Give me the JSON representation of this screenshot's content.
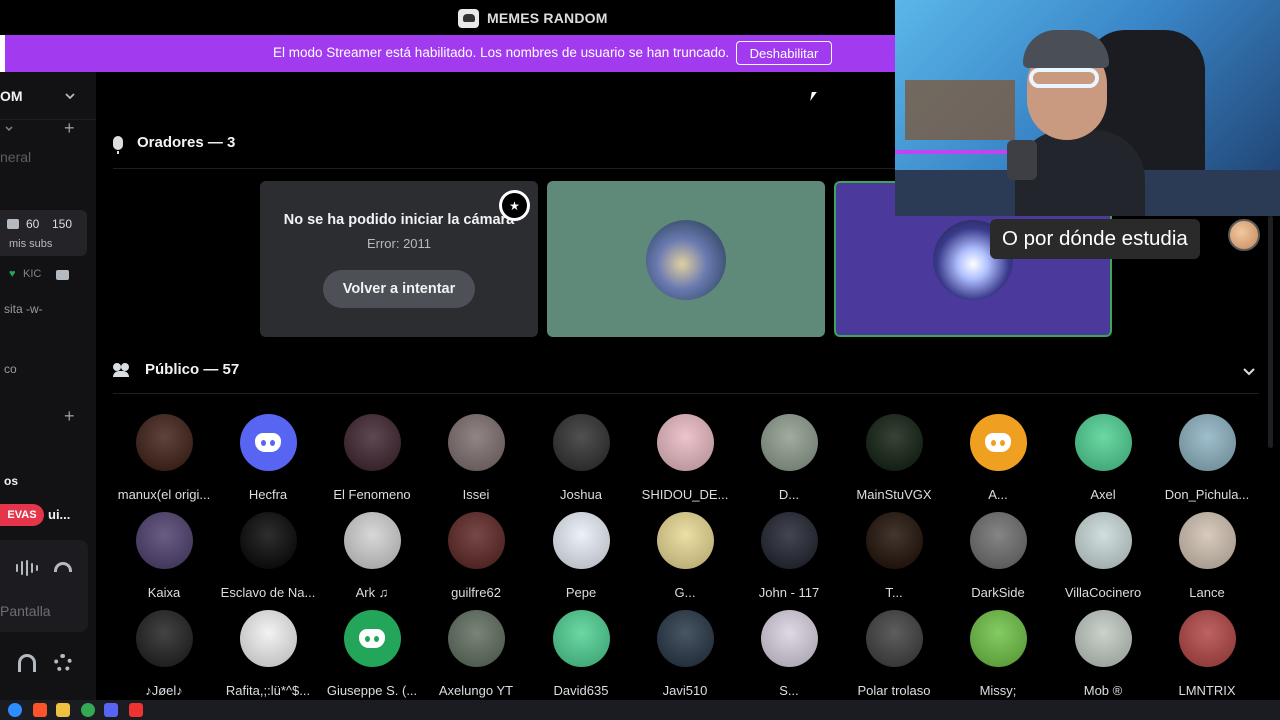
{
  "window": {
    "server_title": "MEMES RANDOM"
  },
  "banner": {
    "message": "El modo Streamer está habilitado. Los nombres de usuario se han truncado.",
    "button": "Deshabilitar"
  },
  "sidebar": {
    "server_name_fragment": "OM",
    "channel_fragment_general": "neral",
    "voice_count_a": "60",
    "voice_count_b": "150",
    "voice_sub": "mis subs",
    "heart_label": "KIC",
    "channel_fragment_sita": "sita -w-",
    "channel_fragment_co": "co",
    "section_fragment": "os",
    "new_pill": "EVAS",
    "new_channel_fragment": "ui...",
    "pantalla": "Pantalla"
  },
  "stage": {
    "speakers_header": "Oradores — 3",
    "camera_error_title": "No se ha podido iniciar la cámara",
    "camera_error_code": "Error: 2011",
    "retry_button": "Volver a intentar",
    "audience_header": "Público — 57"
  },
  "audience": [
    {
      "name": "manux(el origi...",
      "color": "#3a1a10"
    },
    {
      "name": "Hecfra",
      "color": "#5865f2",
      "discord": true
    },
    {
      "name": "El Fenomeno",
      "color": "#3a1f2a"
    },
    {
      "name": "Issei",
      "color": "#7a6a6a"
    },
    {
      "name": "Joshua",
      "color": "#2a2a2a"
    },
    {
      "name": "SHIDOU_DE...",
      "color": "#e8b8c0"
    },
    {
      "name": "D...",
      "color": "#8a9a8a"
    },
    {
      "name": "MainStuVGX",
      "color": "#0a1a0a"
    },
    {
      "name": "A...",
      "color": "#f0a020",
      "discord": true
    },
    {
      "name": "Axel",
      "color": "#4ad090"
    },
    {
      "name": "Don_Pichula...",
      "color": "#8ab0c0"
    },
    {
      "name": "Kaixa",
      "color": "#4a3a6a"
    },
    {
      "name": "Esclavo de Na...",
      "color": "#000000"
    },
    {
      "name": "Ark ♫",
      "color": "#d0d0d0"
    },
    {
      "name": "guilfre62",
      "color": "#5a2020"
    },
    {
      "name": "Pepe",
      "color": "#e8eef8"
    },
    {
      "name": "G...",
      "color": "#e8d890"
    },
    {
      "name": "John - 117",
      "color": "#1a1e2a"
    },
    {
      "name": "T...",
      "color": "#1a0a00"
    },
    {
      "name": "DarkSide",
      "color": "#6a6a6a"
    },
    {
      "name": "VillaCocinero",
      "color": "#c8d8d8"
    },
    {
      "name": "Lance",
      "color": "#d0c0b0"
    },
    {
      "name": "♪Jøel♪",
      "color": "#1a1a1a"
    },
    {
      "name": "Rafita,;:lü*^$...",
      "color": "#f0f0f0"
    },
    {
      "name": "Giuseppe S. (...",
      "color": "#23a55a",
      "discord": true
    },
    {
      "name": "Axelungo YT",
      "color": "#5a6a5a"
    },
    {
      "name": "David635",
      "color": "#4ad090"
    },
    {
      "name": "Javi510",
      "color": "#203040"
    },
    {
      "name": "S...",
      "color": "#d8d0e0"
    },
    {
      "name": "Polar trolaso",
      "color": "#3a3a3a"
    },
    {
      "name": "Missy;",
      "color": "#6ac040"
    },
    {
      "name": "Mob ®",
      "color": "#c0c8c0"
    },
    {
      "name": "LMNTRIX",
      "color": "#b04040"
    }
  ],
  "overlay": {
    "caption": "O por dónde estudia"
  },
  "colors": {
    "banner_purple": "#a23bf0",
    "speaking_green": "#3ba55c",
    "discord_blurple": "#5865f2",
    "new_red": "#e5354b"
  }
}
